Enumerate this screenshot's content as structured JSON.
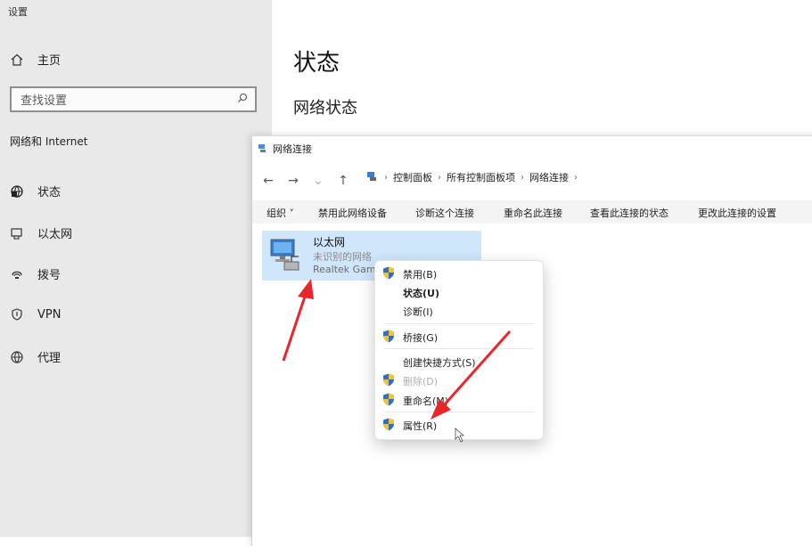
{
  "settings": {
    "window_title": "设置",
    "home_label": "主页",
    "search_placeholder": "查找设置",
    "section_label": "网络和 Internet",
    "nav_items": [
      {
        "label": "状态",
        "icon": "globe-network-icon"
      },
      {
        "label": "以太网",
        "icon": "ethernet-icon"
      },
      {
        "label": "拨号",
        "icon": "dialup-icon"
      },
      {
        "label": "VPN",
        "icon": "vpn-shield-icon"
      },
      {
        "label": "代理",
        "icon": "proxy-globe-icon"
      }
    ],
    "page_title": "状态",
    "page_subtitle": "网络状态"
  },
  "netwin": {
    "title": "网络连接",
    "breadcrumb": [
      "控制面板",
      "所有控制面板项",
      "网络连接"
    ],
    "commands": [
      "组织",
      "禁用此网络设备",
      "诊断这个连接",
      "重命名此连接",
      "查看此连接的状态",
      "更改此连接的设置"
    ],
    "adapter": {
      "name": "以太网",
      "status": "未识别的网络",
      "device": "Realtek Gam"
    }
  },
  "context_menu": {
    "items": [
      {
        "label": "禁用(B)",
        "shield": true,
        "bold": false,
        "disabled": false
      },
      {
        "label": "状态(U)",
        "shield": false,
        "bold": true,
        "disabled": false
      },
      {
        "label": "诊断(I)",
        "shield": false,
        "bold": false,
        "disabled": false
      },
      {
        "label": "桥接(G)",
        "shield": true,
        "bold": false,
        "disabled": false
      },
      {
        "label": "创建快捷方式(S)",
        "shield": false,
        "bold": false,
        "disabled": false
      },
      {
        "label": "删除(D)",
        "shield": true,
        "bold": false,
        "disabled": true
      },
      {
        "label": "重命名(M)",
        "shield": true,
        "bold": false,
        "disabled": false
      },
      {
        "label": "属性(R)",
        "shield": true,
        "bold": false,
        "disabled": false
      }
    ]
  },
  "colors": {
    "sidebar_bg": "#e9e9e9",
    "selection_bg": "#cfe6fb",
    "annotation_arrow": "#e8262c"
  }
}
